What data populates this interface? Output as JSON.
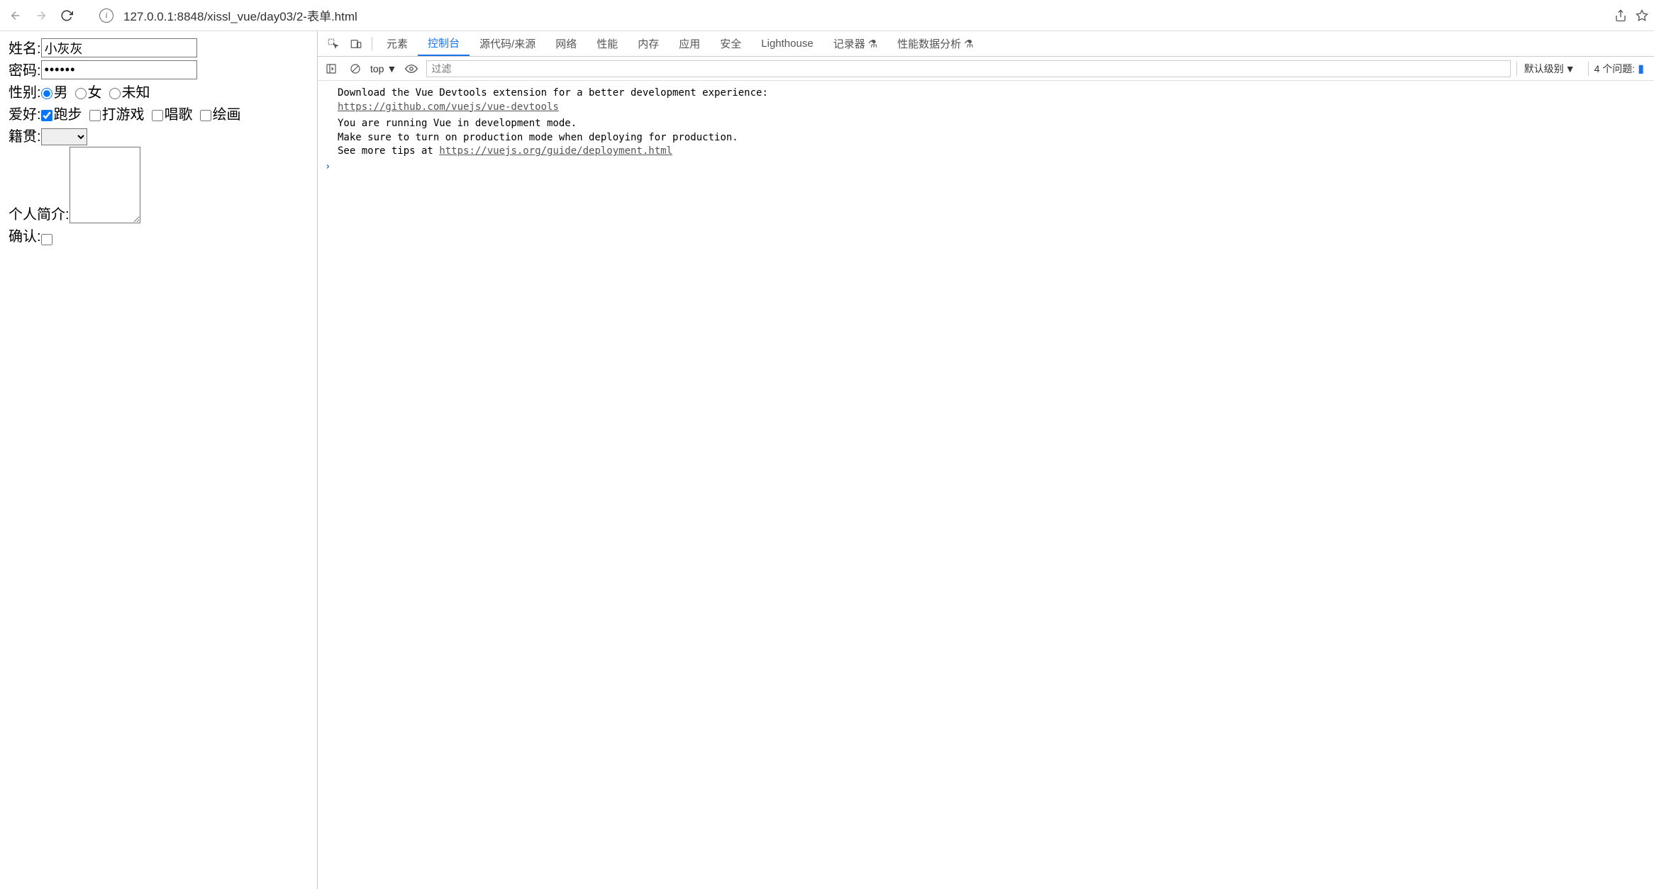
{
  "browser": {
    "url": "127.0.0.1:8848/xissl_vue/day03/2-表单.html"
  },
  "form": {
    "name_label": "姓名:",
    "name_value": "小灰灰",
    "password_label": "密码:",
    "password_value": "••••••",
    "gender_label": "性别:",
    "gender_options": {
      "male": "男",
      "female": "女",
      "unknown": "未知"
    },
    "hobby_label": "爱好:",
    "hobby_options": {
      "run": "跑步",
      "game": "打游戏",
      "sing": "唱歌",
      "paint": "绘画"
    },
    "origin_label": "籍贯:",
    "bio_label": "个人简介:",
    "confirm_label": "确认:"
  },
  "devtools": {
    "tabs": {
      "elements": "元素",
      "console": "控制台",
      "sources": "源代码/来源",
      "network": "网络",
      "performance": "性能",
      "memory": "内存",
      "application": "应用",
      "security": "安全",
      "lighthouse": "Lighthouse",
      "recorder": "记录器",
      "perf_insights": "性能数据分析"
    },
    "context": "top",
    "filter_placeholder": "过滤",
    "level": "默认级别",
    "issues": "4 个问题:",
    "console_msg1_line1": "Download the Vue Devtools extension for a better development experience:",
    "console_msg1_link": "https://github.com/vuejs/vue-devtools",
    "console_msg2_line1": "You are running Vue in development mode.",
    "console_msg2_line2": "Make sure to turn on production mode when deploying for production.",
    "console_msg2_line3_prefix": "See more tips at ",
    "console_msg2_link": "https://vuejs.org/guide/deployment.html"
  }
}
